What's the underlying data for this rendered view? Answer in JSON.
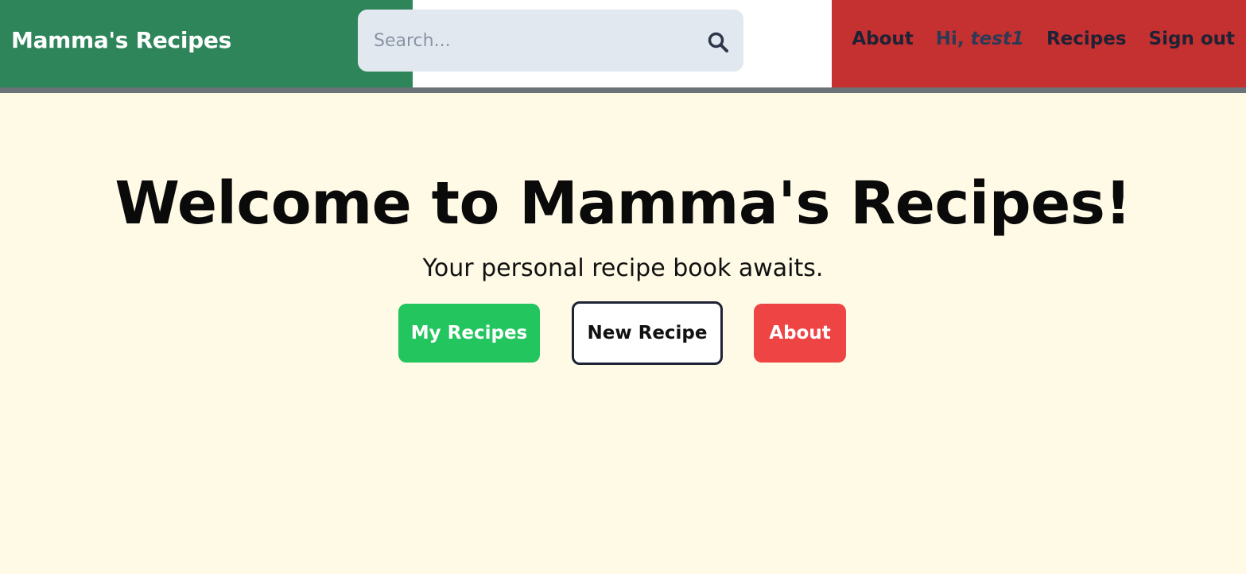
{
  "navbar": {
    "brand": "Mamma's Recipes",
    "search": {
      "placeholder": "Search...",
      "value": ""
    },
    "links": {
      "about": "About",
      "greeting_prefix": "Hi, ",
      "username": "test1",
      "recipes": "Recipes",
      "signout": "Sign out"
    },
    "colors": {
      "green": "#2e855a",
      "white": "#ffffff",
      "red": "#c53030",
      "border": "#6b7278"
    }
  },
  "hero": {
    "title": "Welcome to Mamma's Recipes!",
    "subtitle": "Your personal recipe book awaits.",
    "buttons": {
      "my_recipes": "My Recipes",
      "new_recipe": "New Recipe",
      "about": "About"
    },
    "colors": {
      "background": "#fefae6",
      "green": "#22c55e",
      "red": "#ef4444"
    }
  },
  "icons": {
    "search": "search-icon"
  }
}
